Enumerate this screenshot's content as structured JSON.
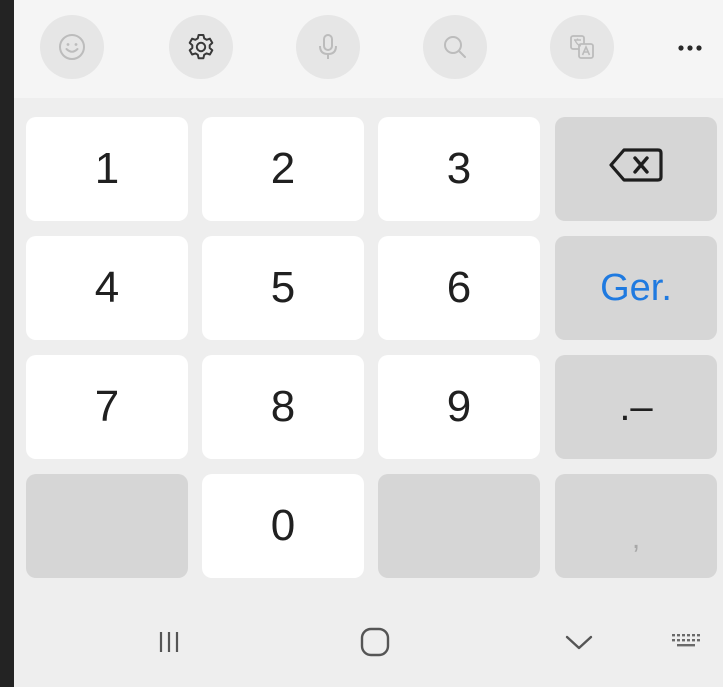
{
  "toolbar": {
    "buttons": [
      {
        "icon": "emoji-icon",
        "label": "Emoji"
      },
      {
        "icon": "gear-icon",
        "label": "Settings"
      },
      {
        "icon": "microphone-icon",
        "label": "Voice input"
      },
      {
        "icon": "search-icon",
        "label": "Search"
      },
      {
        "icon": "translate-icon",
        "label": "Translate"
      }
    ],
    "more_icon": "more-horizontal-icon"
  },
  "keys": {
    "k1": "1",
    "k2": "2",
    "k3": "3",
    "k4": "4",
    "k5": "5",
    "k6": "6",
    "k7": "7",
    "k8": "8",
    "k9": "9",
    "k0": "0",
    "go_label": "Ger.",
    "dot_dash_label": ".–",
    "comma_label": ",",
    "backspace_icon": "backspace-icon"
  },
  "navbar": {
    "recents_icon": "recent-apps-icon",
    "home_icon": "home-icon",
    "back_icon": "chevron-down-icon",
    "keyboard_icon": "keyboard-icon"
  },
  "colors": {
    "accent": "#1f7ae0",
    "key_bg": "#ffffff",
    "fn_key_bg": "#d6d6d6",
    "panel_bg": "#eeeeee"
  }
}
